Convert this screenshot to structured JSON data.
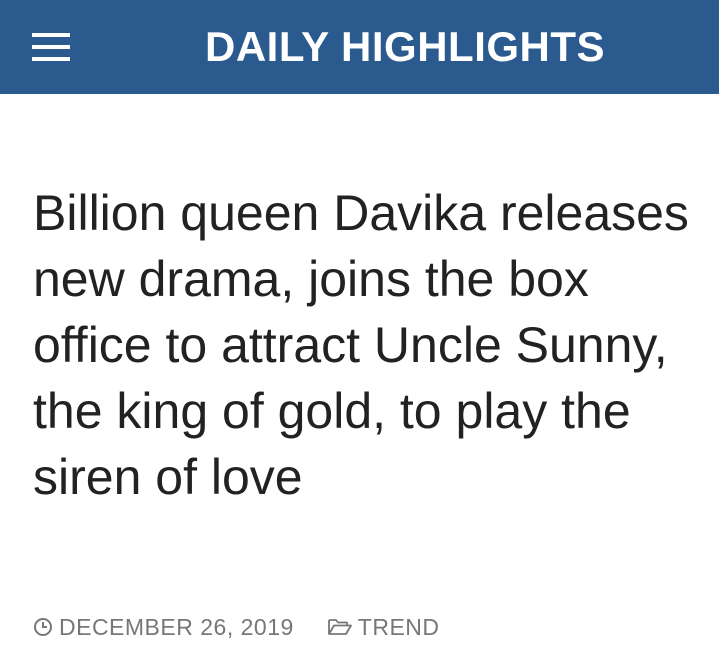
{
  "colors": {
    "brand": "#2a5a8e",
    "headline_text": "#222222",
    "meta_text": "#777777"
  },
  "header": {
    "menu_icon": "hamburger-menu-icon",
    "site_title": "DAILY HIGHLIGHTS"
  },
  "article": {
    "title": "Billion queen Davika releases new drama, joins the box office to attract Uncle Sunny, the king of gold, to play the siren of love",
    "meta": {
      "date_icon": "clock-icon",
      "date": "DECEMBER 26, 2019",
      "category_icon": "folder-icon",
      "category": "TREND"
    }
  }
}
